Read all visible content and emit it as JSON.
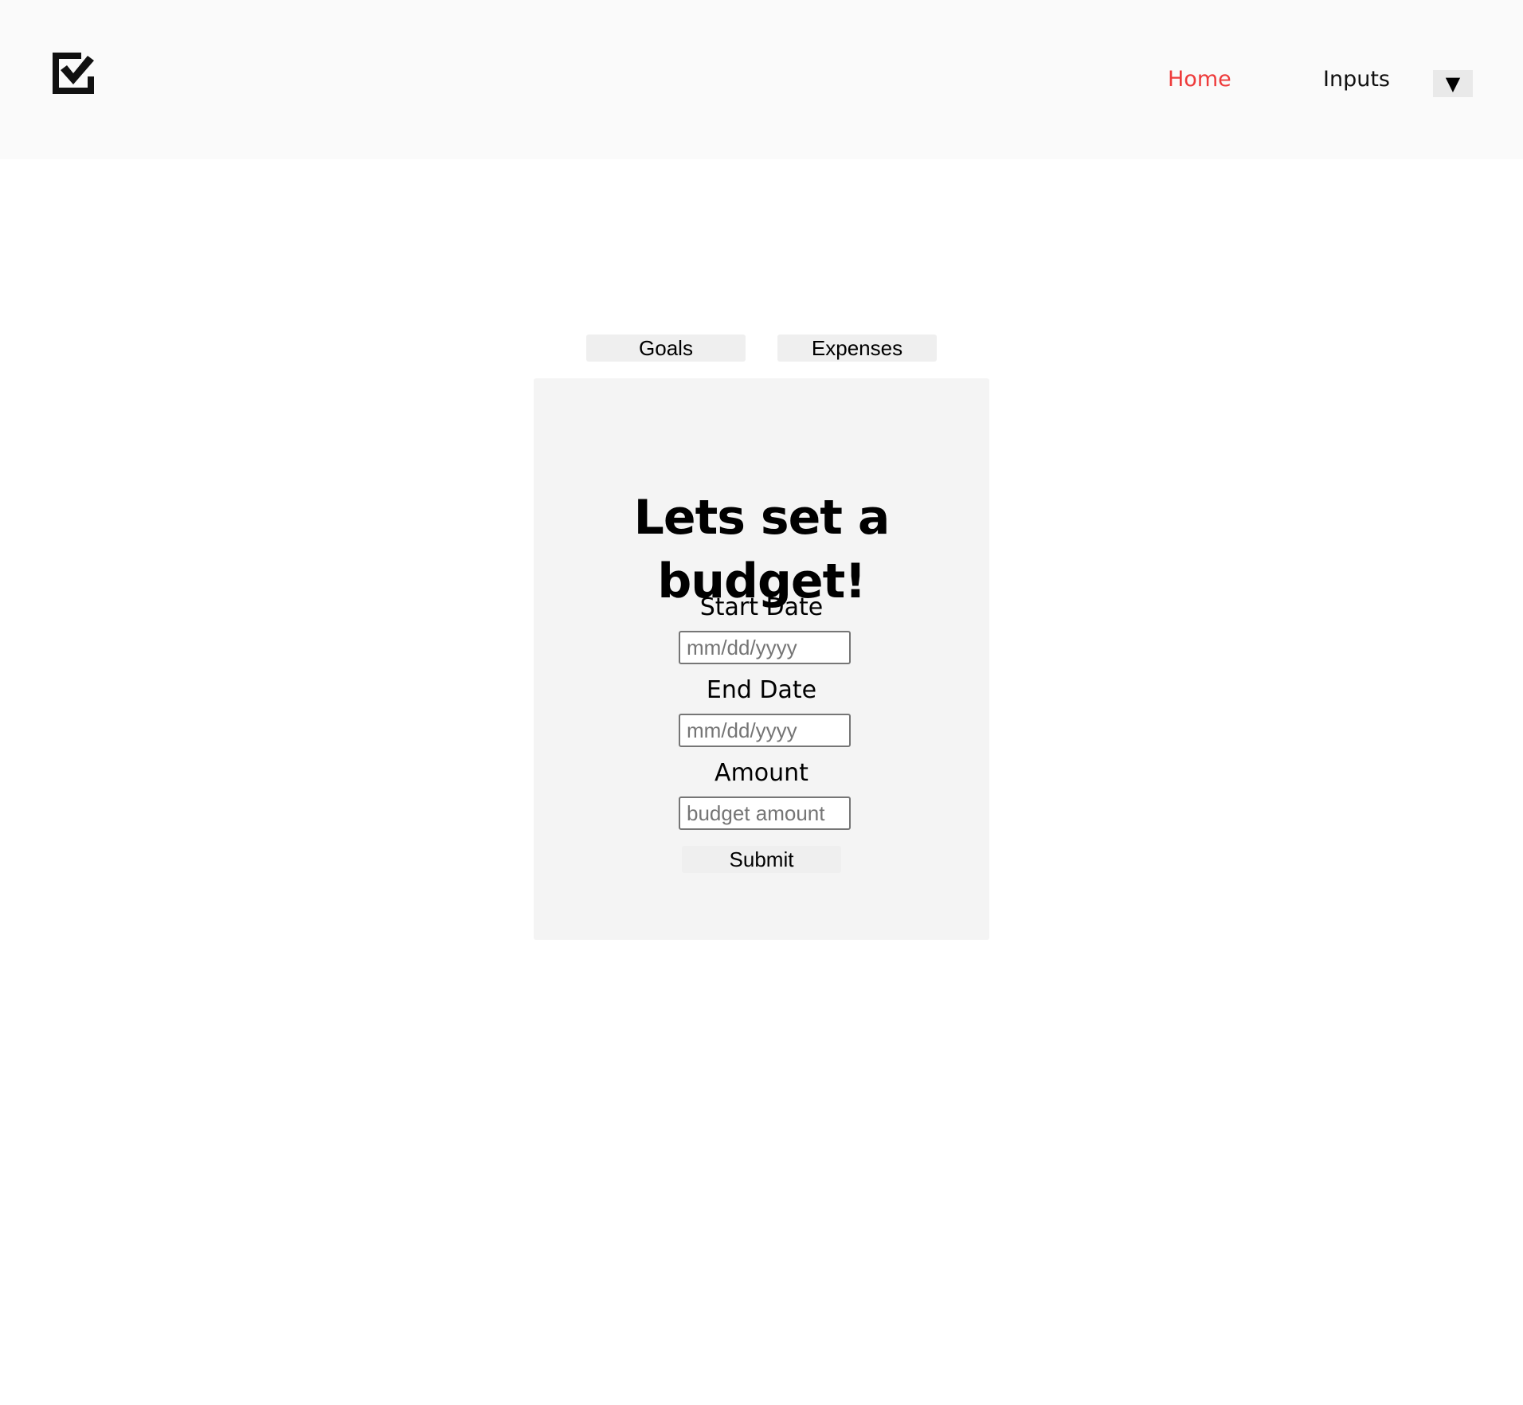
{
  "header": {
    "logo_icon": "checkbox-checked-icon",
    "nav": {
      "home_label": "Home",
      "inputs_label": "Inputs",
      "dropdown_glyph": "▼",
      "dropdown_icon": "caret-down-icon"
    },
    "colors": {
      "active_link": "#ee3b3b",
      "background": "#fafafa"
    }
  },
  "tabs": {
    "goals_label": "Goals",
    "expenses_label": "Expenses"
  },
  "form": {
    "title": "Lets set a budget!",
    "start_date": {
      "label": "Start Date",
      "placeholder": "mm/dd/yyyy"
    },
    "end_date": {
      "label": "End Date",
      "placeholder": "mm/dd/yyyy"
    },
    "amount": {
      "label": "Amount",
      "placeholder": "budget amount"
    },
    "submit_label": "Submit"
  }
}
